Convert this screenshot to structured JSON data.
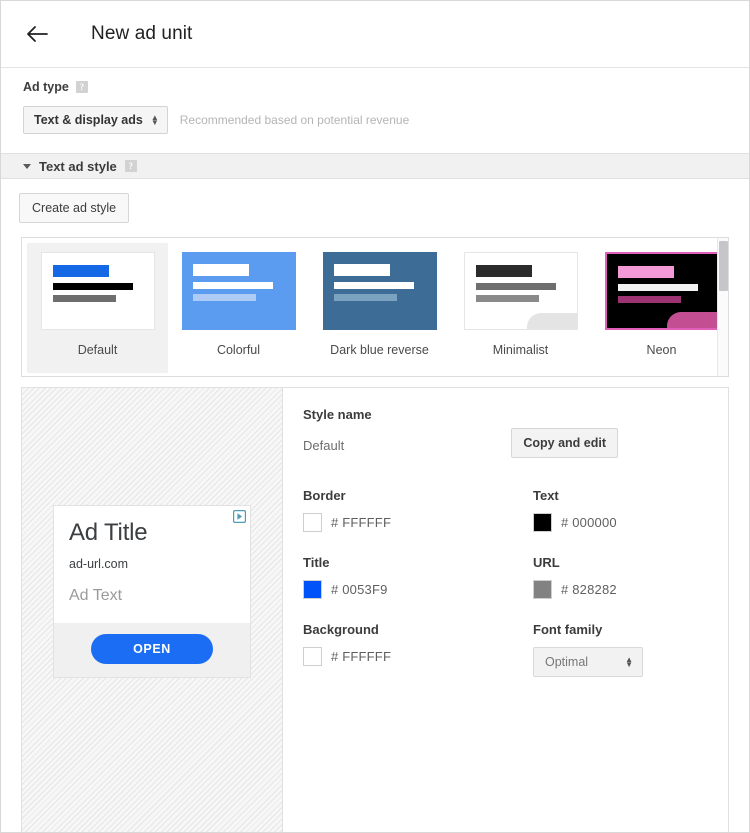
{
  "header": {
    "back_icon": "arrow-left-icon",
    "title": "New ad unit"
  },
  "ad_type": {
    "label": "Ad type",
    "help_icon": "?",
    "selected": "Text & display ads",
    "recommendation": "Recommended based on potential revenue"
  },
  "section": {
    "title": "Text ad style",
    "help_icon": "?",
    "create_button": "Create ad style"
  },
  "styles": [
    {
      "name": "Default",
      "selected": true,
      "thumb": {
        "variant": "t-default",
        "title_color": "#1568E5",
        "text_color": "#000000",
        "url_color": "#6E6E6E",
        "corner_color": ""
      }
    },
    {
      "name": "Colorful",
      "selected": false,
      "thumb": {
        "variant": "t-colorful",
        "title_color": "#FFFFFF",
        "text_color": "#FFFFFF",
        "url_color": "#AECBF5",
        "corner_color": ""
      }
    },
    {
      "name": "Dark blue reverse",
      "selected": false,
      "thumb": {
        "variant": "t-darkblue",
        "title_color": "#FFFFFF",
        "text_color": "#FFFFFF",
        "url_color": "#7BA3C0",
        "corner_color": ""
      }
    },
    {
      "name": "Minimalist",
      "selected": false,
      "thumb": {
        "variant": "t-minimal",
        "title_color": "#2B2B2B",
        "text_color": "#6E6E6E",
        "url_color": "#8A8A8A",
        "corner_color": "#E4E4E4"
      }
    },
    {
      "name": "Neon",
      "selected": false,
      "thumb": {
        "variant": "t-neon",
        "title_color": "#F49AD6",
        "text_color": "#F2F2F2",
        "url_color": "#9E3374",
        "corner_color": "#C34E92"
      }
    }
  ],
  "preview": {
    "title": "Ad Title",
    "url": "ad-url.com",
    "text": "Ad Text",
    "button": "OPEN",
    "adchoices_icon": "adchoices-icon"
  },
  "detail": {
    "style_name_label": "Style name",
    "style_name_value": "Default",
    "copy_button": "Copy and edit",
    "fields": [
      {
        "label": "Border",
        "value": "# FFFFFF",
        "swatch": "#FFFFFF"
      },
      {
        "label": "Text",
        "value": "# 000000",
        "swatch": "#000000"
      },
      {
        "label": "Title",
        "value": "# 0053F9",
        "swatch": "#0053F9"
      },
      {
        "label": "URL",
        "value": "# 828282",
        "swatch": "#828282"
      },
      {
        "label": "Background",
        "value": "# FFFFFF",
        "swatch": "#FFFFFF"
      },
      {
        "label": "Font family",
        "value": "Optimal",
        "swatch": ""
      }
    ]
  }
}
